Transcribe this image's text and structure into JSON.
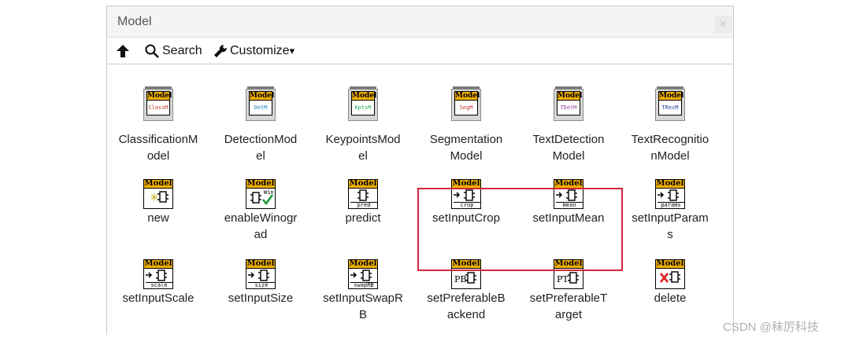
{
  "palette": {
    "title": "Model",
    "close_glyph": "×",
    "toolbar": {
      "up_icon": "up-arrow-icon",
      "search_label": "Search",
      "search_icon": "magnifier-icon",
      "customize_label": "Customize",
      "customize_icon": "wrench-icon",
      "customize_arrow": "▾"
    },
    "items": [
      {
        "label": "ClassificationModel",
        "line1": "ClassificationM",
        "line2": "odel",
        "kind": "class",
        "tag": "ClassM",
        "tag_color": "#c0392b"
      },
      {
        "label": "DetectionModel",
        "line1": "DetectionMod",
        "line2": "el",
        "kind": "class",
        "tag": "DetM",
        "tag_color": "#2e86c1"
      },
      {
        "label": "KeypointsModel",
        "line1": "KeypointsMod",
        "line2": "el",
        "kind": "class",
        "tag": "KptsM",
        "tag_color": "#27ae60"
      },
      {
        "label": "SegmentationModel",
        "line1": "Segmentation",
        "line2": "Model",
        "kind": "class",
        "tag": "SegM",
        "tag_color": "#c0392b"
      },
      {
        "label": "TextDetectionModel",
        "line1": "TextDetection",
        "line2": "Model",
        "kind": "class",
        "tag": "TDetM",
        "tag_color": "#8e44ad"
      },
      {
        "label": "TextRecognitionModel",
        "line1": "TextRecognitio",
        "line2": "nModel",
        "kind": "class",
        "tag": "TRecM",
        "tag_color": "#1f3fa0"
      },
      {
        "label": "new",
        "line1": "new",
        "line2": "",
        "kind": "method",
        "glyph": "new",
        "sub": ""
      },
      {
        "label": "enableWinograd",
        "line1": "enableWinogr",
        "line2": "ad",
        "kind": "method",
        "glyph": "check",
        "sub": "Win"
      },
      {
        "label": "predict",
        "line1": "predict",
        "line2": "",
        "kind": "method",
        "glyph": "plain",
        "sub": "pred"
      },
      {
        "label": "setInputCrop",
        "line1": "setInputCrop",
        "line2": "",
        "kind": "method",
        "glyph": "set",
        "sub": "crop"
      },
      {
        "label": "setInputMean",
        "line1": "setInputMean",
        "line2": "",
        "kind": "method",
        "glyph": "set",
        "sub": "mean"
      },
      {
        "label": "setInputParams",
        "line1": "setInputParam",
        "line2": "s",
        "kind": "method",
        "glyph": "set",
        "sub": "params"
      },
      {
        "label": "setInputScale",
        "line1": "setInputScale",
        "line2": "",
        "kind": "method",
        "glyph": "set",
        "sub": "scale"
      },
      {
        "label": "setInputSize",
        "line1": "setInputSize",
        "line2": "",
        "kind": "method",
        "glyph": "set",
        "sub": "size"
      },
      {
        "label": "setInputSwapRB",
        "line1": "setInputSwapR",
        "line2": "B",
        "kind": "method",
        "glyph": "set",
        "sub": "swapRB"
      },
      {
        "label": "setPreferableBackend",
        "line1": "setPreferableB",
        "line2": "ackend",
        "kind": "method",
        "glyph": "text",
        "sub": "PB"
      },
      {
        "label": "setPreferableTarget",
        "line1": "setPreferableT",
        "line2": "arget",
        "kind": "method",
        "glyph": "text",
        "sub": "PT"
      },
      {
        "label": "delete",
        "line1": "delete",
        "line2": "",
        "kind": "method",
        "glyph": "delete",
        "sub": ""
      }
    ],
    "icon_header": "Model",
    "highlight_color": "#d4263c"
  },
  "watermark": "CSDN @秣厉科技"
}
